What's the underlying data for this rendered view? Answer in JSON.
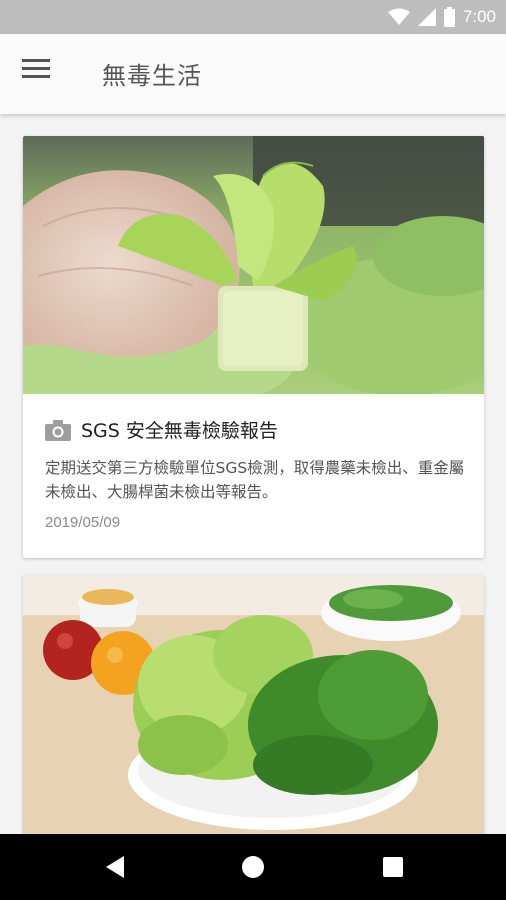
{
  "status_bar": {
    "time": "7:00",
    "icons": [
      "wifi-icon",
      "signal-icon",
      "battery-icon"
    ]
  },
  "app_bar": {
    "title": "無毒生活",
    "menu_icon": "hamburger-menu-icon"
  },
  "cards": [
    {
      "icon": "camera-icon",
      "title": "SGS 安全無毒檢驗報告",
      "description": "定期送交第三方檢驗單位SGS檢測，取得農藥未檢出、重金屬未檢出、大腸桿菌未檢出等報告。",
      "date": "2019/05/09",
      "image": "lettuce-seedling-gloved-hand-photo"
    },
    {
      "image": "salad-plate-with-fruits-photo"
    }
  ],
  "nav_bar": {
    "buttons": [
      "back-icon",
      "home-icon",
      "recents-icon"
    ]
  },
  "colors": {
    "status_bar": "#bdbdbd",
    "app_bar": "#fafafa",
    "background": "#f3f3f3",
    "nav_bar": "#000000"
  }
}
